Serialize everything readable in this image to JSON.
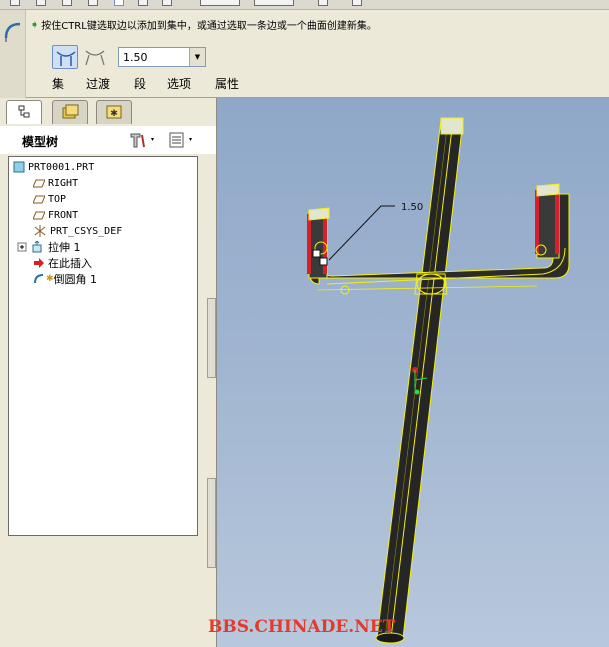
{
  "dashboard": {
    "status_message": "按住CTRL键选取边以添加到集中，或通过选取一条边或一个曲面创建新集。",
    "radius_value": "1.50",
    "tabs": [
      "集",
      "过渡",
      "段",
      "选项",
      "属性"
    ]
  },
  "navigator": {
    "title": "模型树",
    "tree": [
      {
        "label": "PRT0001.PRT",
        "icon": "part-icon"
      },
      {
        "label": "RIGHT",
        "icon": "datum-plane-icon"
      },
      {
        "label": "TOP",
        "icon": "datum-plane-icon"
      },
      {
        "label": "FRONT",
        "icon": "datum-plane-icon"
      },
      {
        "label": "PRT_CSYS_DEF",
        "icon": "csys-icon"
      },
      {
        "label": "拉伸 1",
        "icon": "extrude-icon"
      },
      {
        "label": "在此插入",
        "icon": "insert-here-arrow-icon"
      },
      {
        "label": "倒圆角 1",
        "icon": "round-icon"
      }
    ]
  },
  "viewport": {
    "dimension_label": "1.50",
    "watermark": "BBS.CHINADE.NET"
  },
  "colors": {
    "accent_blue": "#6f8fc7",
    "viewport_bg": "#9fb4d0",
    "model_yellow": "#f5f00a",
    "model_red": "#d8202a",
    "watermark_red": "#e23b2e"
  }
}
